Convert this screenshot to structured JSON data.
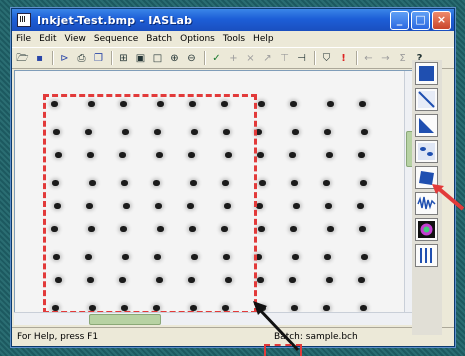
{
  "window": {
    "title": "Inkjet-Test.bmp - IASLab",
    "buttons": {
      "minimize": "_",
      "maximize": "□",
      "close": "×"
    }
  },
  "menubar": {
    "items": [
      "File",
      "Edit",
      "View",
      "Sequence",
      "Batch",
      "Options",
      "Tools",
      "Help"
    ]
  },
  "toolbar": {
    "icons": [
      "open-folder-icon",
      "save-icon",
      "sequence-icon",
      "print-icon",
      "copy-icon",
      "actual-size-icon",
      "fit-page-icon",
      "fit-window-icon",
      "zoom-in-icon",
      "zoom-out-icon",
      "measure-icon",
      "point-tool-icon",
      "delete-point-icon",
      "line-tool-icon",
      "angle-tool-icon",
      "caliper-icon",
      "fill-icon",
      "alert-icon",
      "back-arrow-icon",
      "forward-arrow-icon",
      "sum-icon",
      "help-icon"
    ]
  },
  "statusbar": {
    "left": "For Help, press F1",
    "right": "Batch: sample.bch"
  },
  "image": {
    "grid_columns": 10,
    "grid_rows": 9,
    "dot_color": "#1b1b1b",
    "selection_color": "#e23a3a"
  },
  "side_panel": {
    "tools": [
      "rectangle-region-icon",
      "diagonal-line-icon",
      "triangle-region-icon",
      "dot-detect-icon",
      "rotate-square-icon",
      "waveform-icon",
      "color-wheel-icon",
      "vertical-bars-icon"
    ]
  }
}
